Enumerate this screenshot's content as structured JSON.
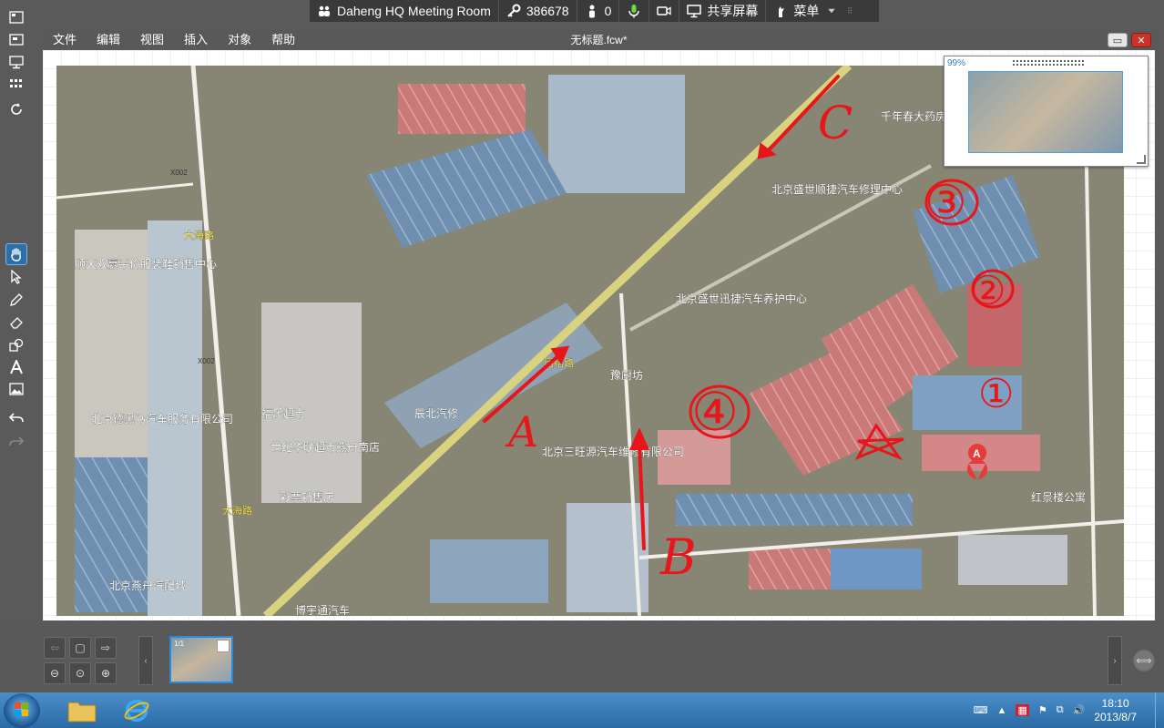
{
  "topbar": {
    "room_name": "Daheng HQ Meeting Room",
    "meeting_id": "386678",
    "participants": "0",
    "share_screen": "共享屏幕",
    "menu": "菜单"
  },
  "menubar": {
    "items": [
      "文件",
      "编辑",
      "视图",
      "插入",
      "对象",
      "帮助"
    ],
    "doc_title": "无标题.fcw*"
  },
  "navigator": {
    "zoom": "99%"
  },
  "map_labels": {
    "pharmacy": "千年春大药房",
    "shengshi_shunjie": "北京盛世顺捷汽车修理中心",
    "shengshi_xunjie": "北京盛世迅捷汽车养护中心",
    "yuchufang": "豫厨坊",
    "sanwangyuan": "北京三旺源汽车维修有限公司",
    "chenbei": "辰北汽修",
    "fule": "福乐超市",
    "shijihualian": "世纪华联超市燕丹南店",
    "caipiao": "彩票销售店",
    "shuntian": "顺天双赢平价服装鞋销售中心",
    "deheima": "北京德黑马汽车服务有限公司",
    "yandan_parts": "北京燕丹汽配城",
    "hongjinglou": "红景楼公寓",
    "boyitong": "博宇通汽车",
    "dahai_road_1": "大海路",
    "dahai_road_2": "大海路",
    "tuanjie_road": "团结路",
    "road_x002_1": "X002",
    "road_x002_2": "X002",
    "marker_a": "A"
  },
  "annotations": {
    "letter_a": "A",
    "letter_b": "B",
    "letter_c": "C",
    "circle_1": "①",
    "circle_2": "②",
    "circle_3": "③",
    "circle_4": "④"
  },
  "bottombar": {
    "thumb_page": "1/1"
  },
  "taskbar": {
    "time": "18:10",
    "date": "2013/8/7"
  },
  "colors": {
    "annotation_red": "#e8151b",
    "accent_blue": "#2b8ae0",
    "close_red": "#c8342a"
  }
}
